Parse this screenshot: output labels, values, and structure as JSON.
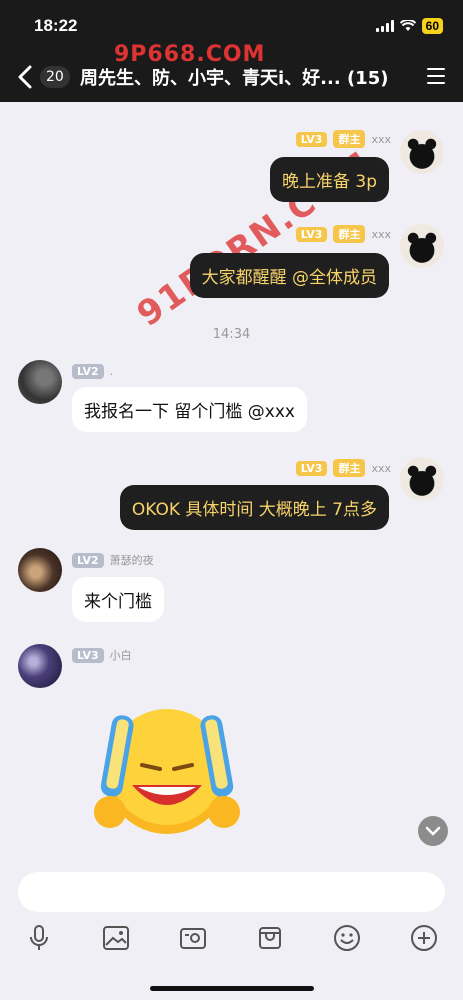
{
  "status": {
    "time": "18:22",
    "battery": "60"
  },
  "watermarks": {
    "top": "9P668.COM",
    "middle": "91PORN.COM"
  },
  "header": {
    "unread": "20",
    "title": "周先生、防、小宇、青天i、好... (15)"
  },
  "messages": [
    {
      "side": "right",
      "level": "LV3",
      "role": "群主",
      "name": "xxx",
      "text": "晚上准备 3p"
    },
    {
      "side": "right",
      "level": "LV3",
      "role": "群主",
      "name": "xxx",
      "text": "大家都醒醒 @全体成员"
    },
    {
      "type": "time",
      "text": "14:34"
    },
    {
      "side": "left",
      "level": "LV2",
      "name": ".",
      "text": "我报名一下   留个门槛 @xxx"
    },
    {
      "side": "right",
      "level": "LV3",
      "role": "群主",
      "name": "xxx",
      "text": "OKOK  具体时间  大概晚上  7点多"
    },
    {
      "side": "left",
      "level": "LV2",
      "name": "萧瑟的夜",
      "text": "来个门槛"
    },
    {
      "side": "left",
      "level": "LV3",
      "name": "小白",
      "text": ""
    }
  ],
  "icons": [
    "microphone-icon",
    "image-icon",
    "camera-icon",
    "bag-icon",
    "smile-icon",
    "plus-icon"
  ],
  "colors": {
    "header": "#1a1a1a",
    "bubble_dark": "#1f1f1f",
    "bubble_text": "#f7d36a",
    "level_gold": "#f6c64b",
    "level_gray": "#b7bccb"
  }
}
